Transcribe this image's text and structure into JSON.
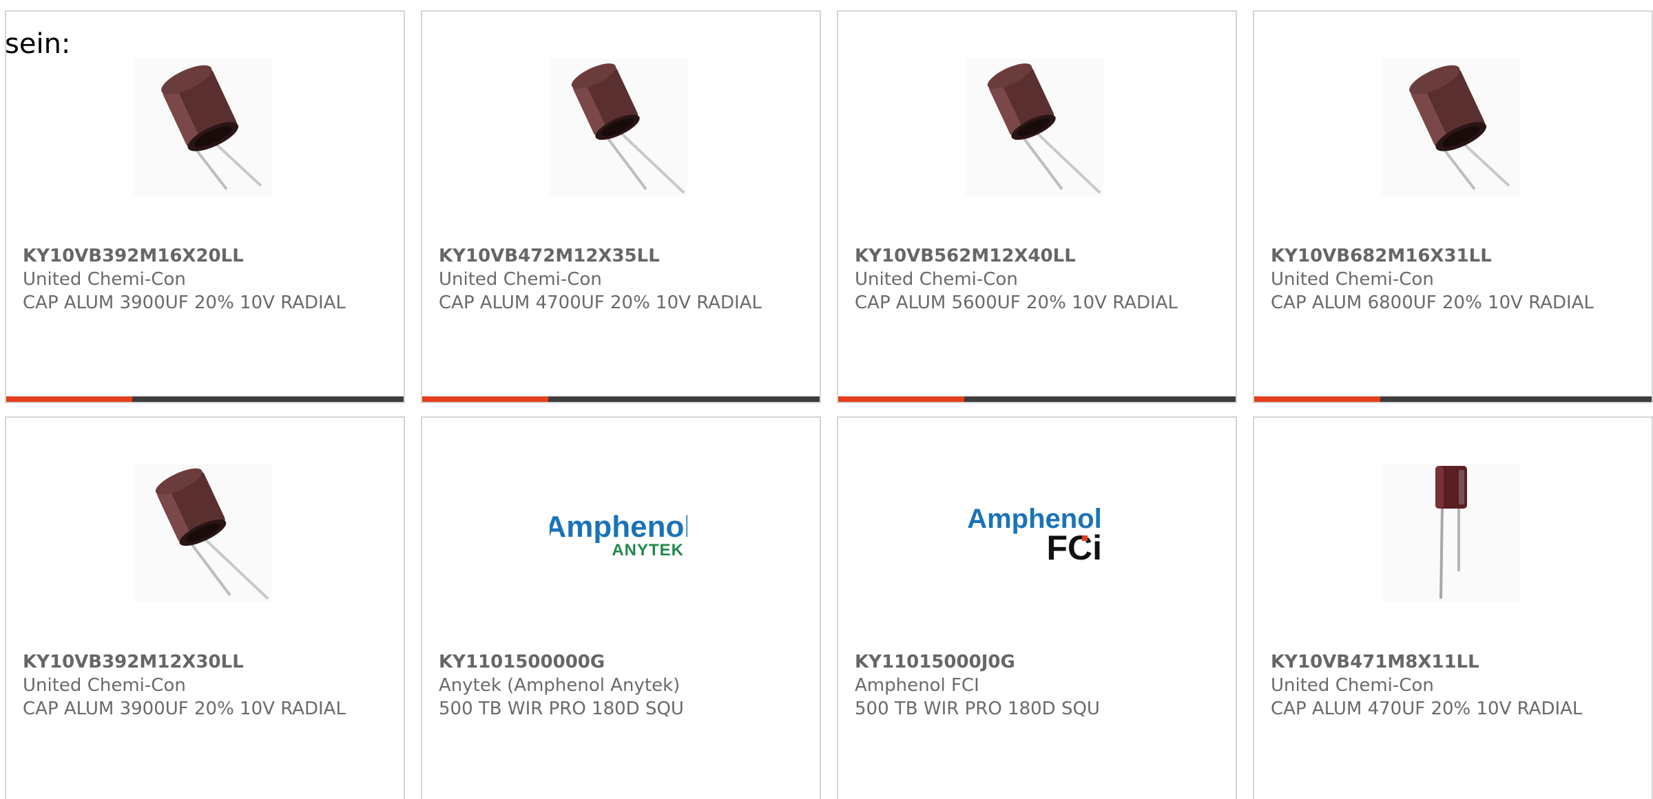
{
  "intro_text": "sein:",
  "colors": {
    "accent": "#e2401c",
    "bar": "#3d3d3d",
    "border": "#d6d6d6",
    "amphenol_blue": "#1a73b8",
    "anytek_green": "#1e8a4a"
  },
  "products": [
    {
      "part_number": "KY10VB392M16X20LL",
      "manufacturer": "United Chemi-Con",
      "description": "CAP ALUM 3900UF 20% 10V RADIAL",
      "image": "capacitor-radial-icon"
    },
    {
      "part_number": "KY10VB472M12X35LL",
      "manufacturer": "United Chemi-Con",
      "description": "CAP ALUM 4700UF 20% 10V RADIAL",
      "image": "capacitor-radial-icon"
    },
    {
      "part_number": "KY10VB562M12X40LL",
      "manufacturer": "United Chemi-Con",
      "description": "CAP ALUM 5600UF 20% 10V RADIAL",
      "image": "capacitor-radial-icon"
    },
    {
      "part_number": "KY10VB682M16X31LL",
      "manufacturer": "United Chemi-Con",
      "description": "CAP ALUM 6800UF 20% 10V RADIAL",
      "image": "capacitor-radial-icon"
    },
    {
      "part_number": "KY10VB392M12X30LL",
      "manufacturer": "United Chemi-Con",
      "description": "CAP ALUM 3900UF 20% 10V RADIAL",
      "image": "capacitor-radial-icon"
    },
    {
      "part_number": "KY1101500000G",
      "manufacturer": "Anytek (Amphenol Anytek)",
      "description": "500 TB WIR PRO 180D SQU",
      "image": "amphenol-anytek-logo",
      "logo": {
        "line1": "Amphenol",
        "line2": "ANYTEK"
      }
    },
    {
      "part_number": "KY11015000J0G",
      "manufacturer": "Amphenol FCI",
      "description": "500 TB WIR PRO 180D SQU",
      "image": "amphenol-fci-logo",
      "logo": {
        "line1": "Amphenol",
        "line2": "FCi"
      }
    },
    {
      "part_number": "KY10VB471M8X11LL",
      "manufacturer": "United Chemi-Con",
      "description": "CAP ALUM 470UF 20% 10V RADIAL",
      "image": "capacitor-small-icon"
    }
  ]
}
